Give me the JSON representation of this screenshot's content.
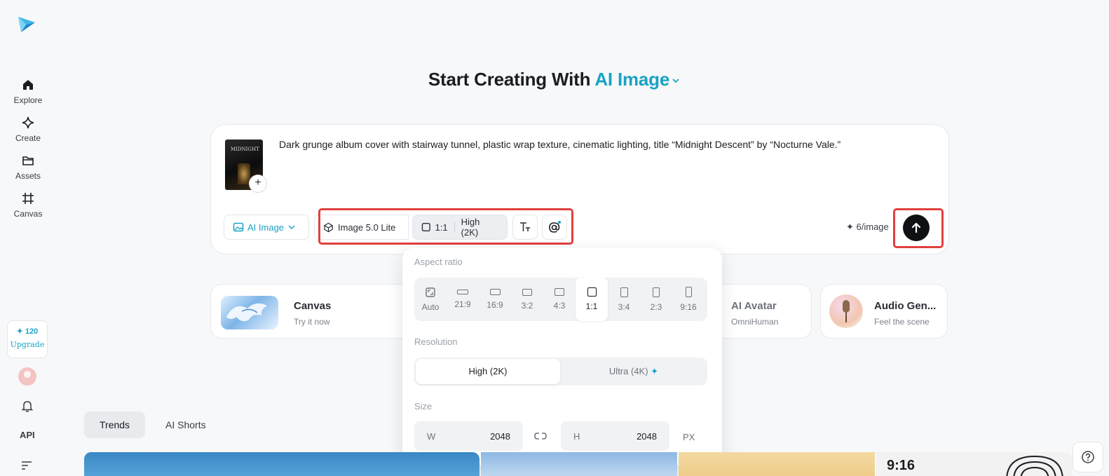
{
  "sidebar": {
    "items": [
      {
        "label": "Explore",
        "icon": "home-icon"
      },
      {
        "label": "Create",
        "icon": "sparkle-icon"
      },
      {
        "label": "Assets",
        "icon": "folder-icon"
      },
      {
        "label": "Canvas",
        "icon": "grid-frame-icon"
      }
    ],
    "credits": "✦ 120",
    "upgrade": "Upgrade",
    "api": "API"
  },
  "header": {
    "prefix": "Start Creating With",
    "accent": "AI Image"
  },
  "prompt": {
    "text": "Dark grunge album cover with stairway tunnel, plastic wrap texture, cinematic lighting, title “Midnight Descent” by “Nocturne Vale.”",
    "thumb_title": "MIDNIGHT",
    "add": "+"
  },
  "toolbar": {
    "mode": "AI Image",
    "model": "Image 5.0 Lite",
    "ratio": "1:1",
    "quality": "High (2K)",
    "cost": "✦ 6/image"
  },
  "features": [
    {
      "title": "Canvas",
      "sub": "Try it now"
    },
    {
      "title": "AI Avatar",
      "sub": "OmniHuman"
    },
    {
      "title": "Audio Gen...",
      "sub": "Feel the scene"
    }
  ],
  "popup": {
    "aspect_label": "Aspect ratio",
    "ratios": [
      "Auto",
      "21:9",
      "16:9",
      "3:2",
      "4:3",
      "1:1",
      "3:4",
      "2:3",
      "9:16"
    ],
    "selected_ratio": "1:1",
    "resolution_label": "Resolution",
    "resolutions": [
      "High (2K)",
      "Ultra (4K)"
    ],
    "size_label": "Size",
    "w_label": "W",
    "w_value": "2048",
    "h_label": "H",
    "h_value": "2048",
    "unit": "PX"
  },
  "tabs": [
    "Trends",
    "AI Shorts"
  ],
  "gallery": {
    "label": "9:16"
  },
  "colors": {
    "accent": "#18a3c4",
    "highlight": "#e0403d",
    "send": "#101114"
  }
}
